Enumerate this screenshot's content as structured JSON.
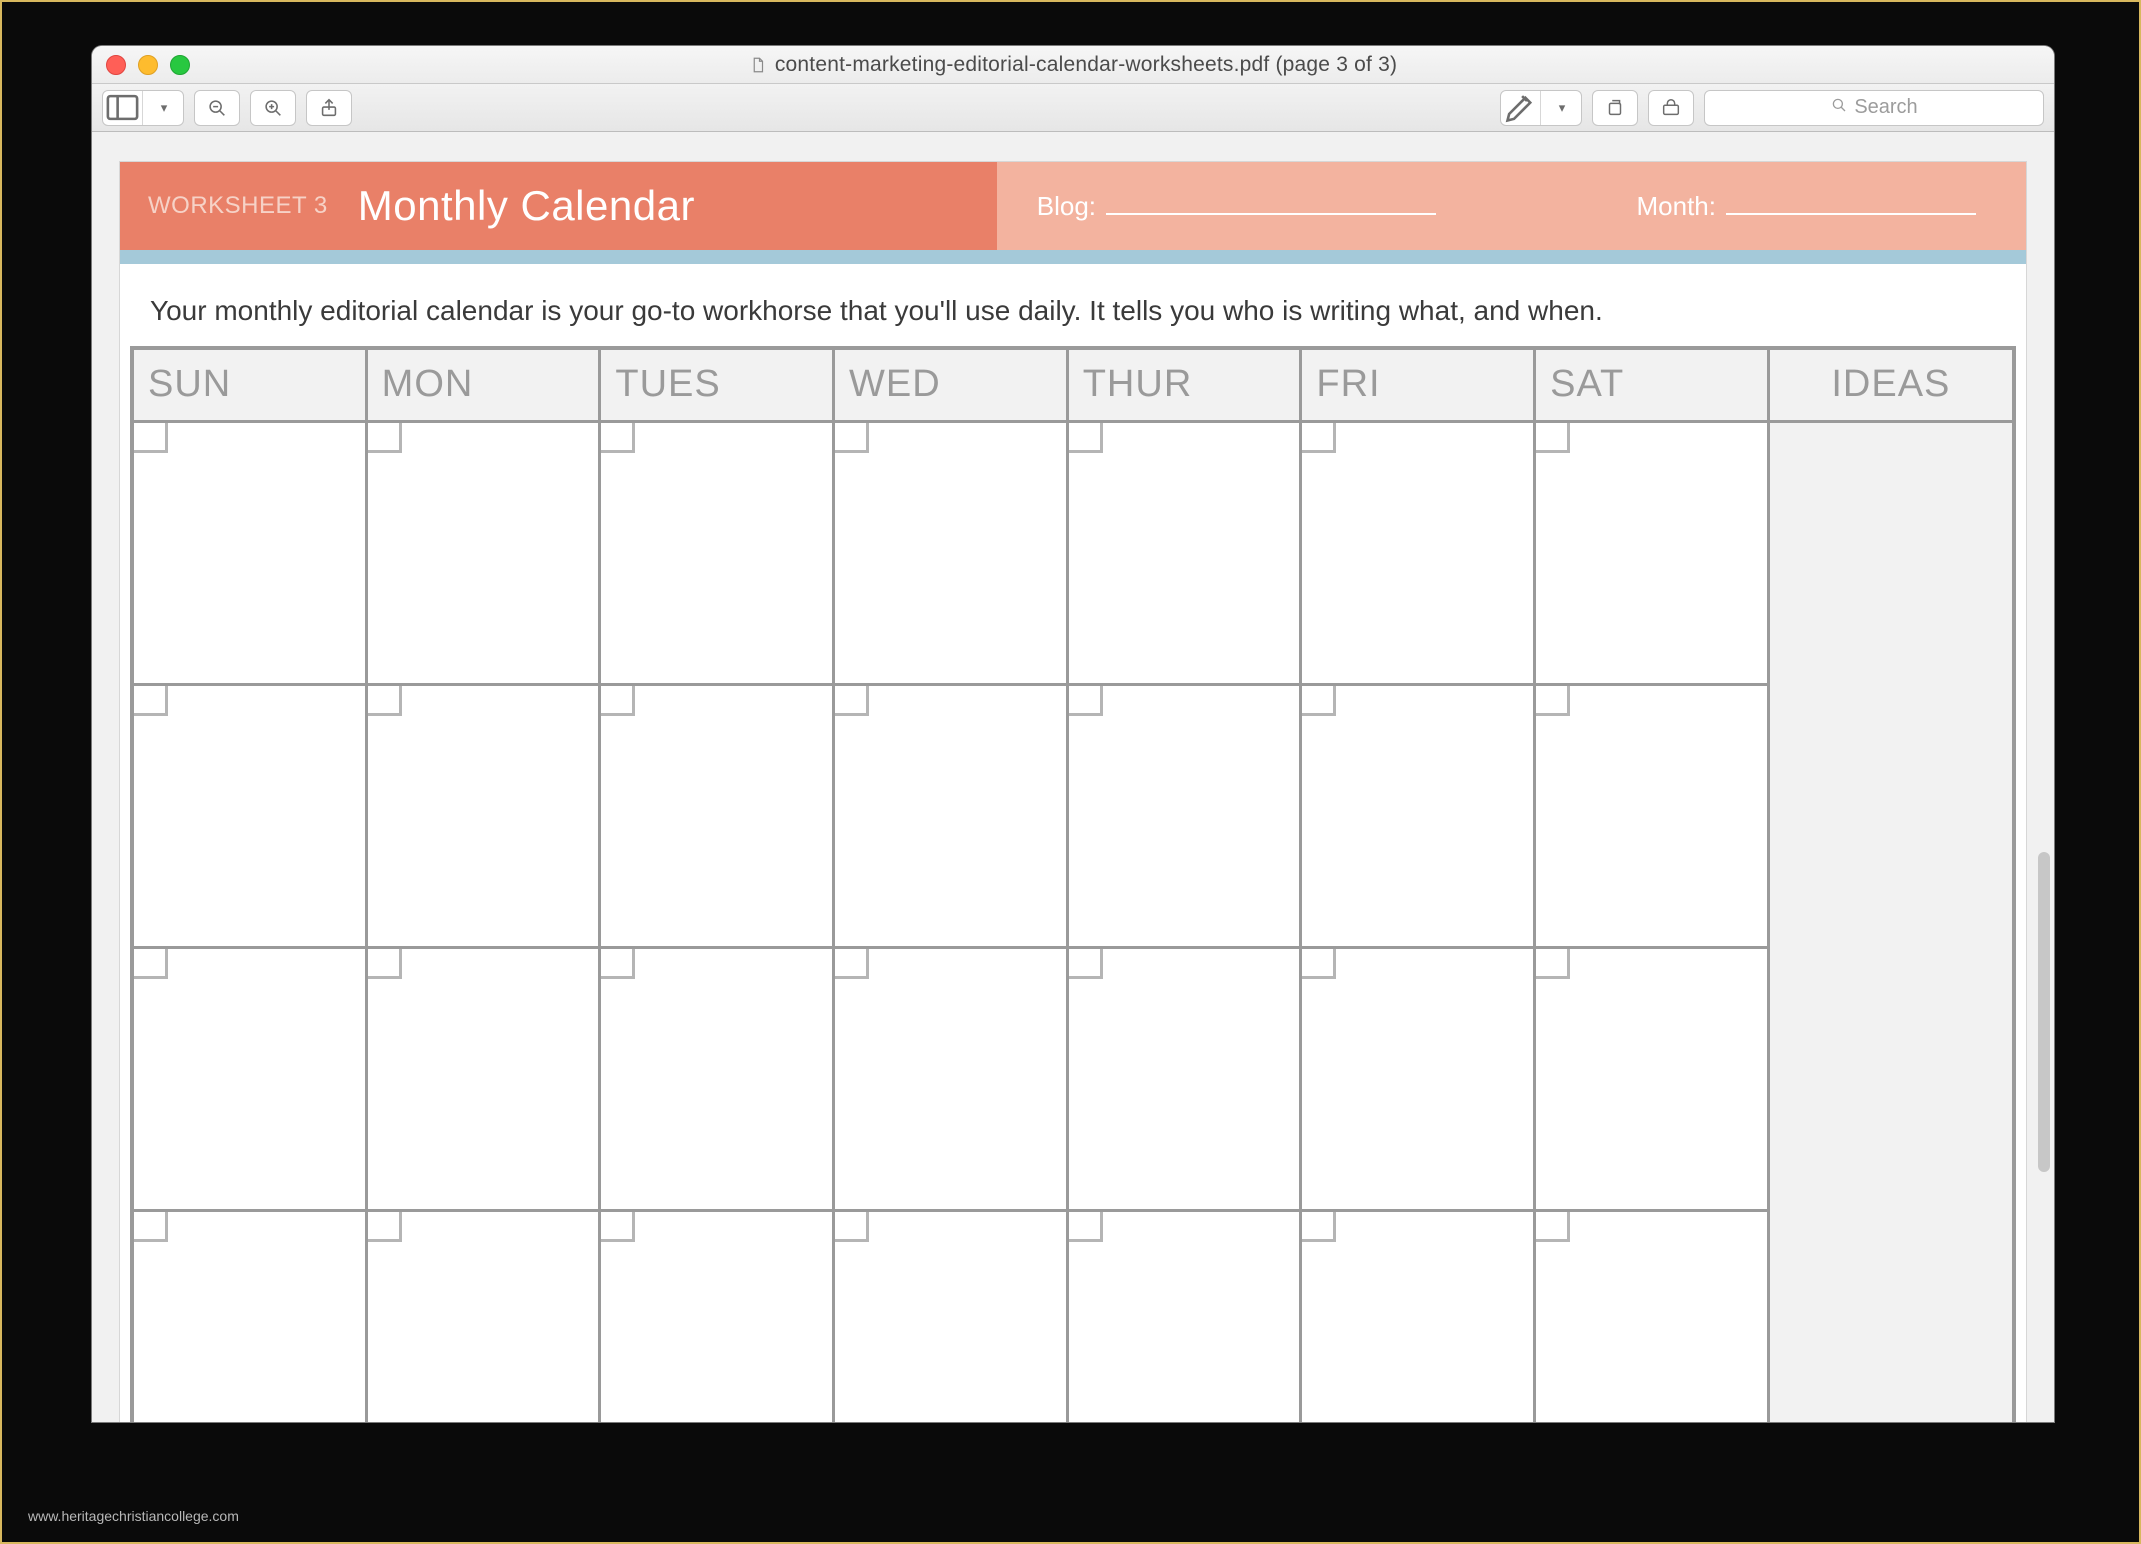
{
  "window": {
    "title": "content-marketing-editorial-calendar-worksheets.pdf (page 3 of 3)",
    "search_placeholder": "Search"
  },
  "document": {
    "worksheet_label": "WORKSHEET 3",
    "worksheet_title": "Monthly Calendar",
    "field_blog_label": "Blog:",
    "field_month_label": "Month:",
    "intro": "Your monthly editorial calendar is your go-to workhorse that you'll use daily. It tells you who is writing what, and when.",
    "days": [
      "SUN",
      "MON",
      "TUES",
      "WED",
      "THUR",
      "FRI",
      "SAT"
    ],
    "ideas_header": "IDEAS"
  },
  "watermark": "www.heritagechristiancollege.com"
}
